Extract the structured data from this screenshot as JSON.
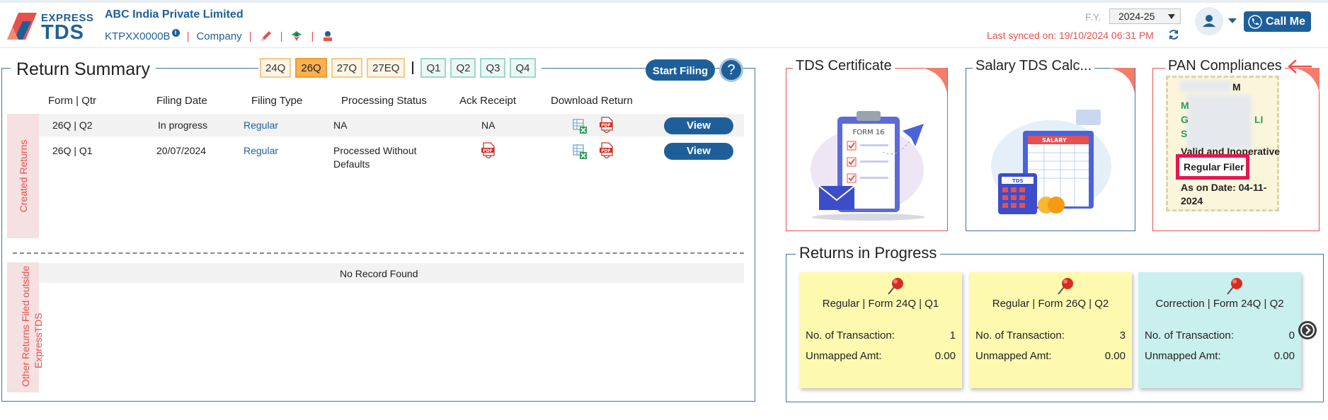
{
  "header": {
    "logo_top": "EXPRESS",
    "logo_bottom": "TDS",
    "company_name": "ABC India Private Limited",
    "tan": "KTPXX0000B",
    "tan_info_glyph": "i",
    "company_link": "Company",
    "separator": "|",
    "fy_label": "F.Y.",
    "fy_value": "2024-25",
    "last_synced": "Last synced on: 19/10/2024 06:31 PM",
    "call_me": "Call Me",
    "colors": {
      "brand": "#1f5f99",
      "accent": "#e8504f"
    }
  },
  "return_summary": {
    "title": "Return Summary",
    "form_tabs": [
      "24Q",
      "26Q",
      "27Q",
      "27EQ"
    ],
    "active_form": "26Q",
    "quarter_tabs": [
      "Q1",
      "Q2",
      "Q3",
      "Q4"
    ],
    "start_filing": "Start Filing",
    "help": "?",
    "columns": [
      "Form | Qtr",
      "Filing Date",
      "Filing Type",
      "Processing Status",
      "Ack Receipt",
      "Download Return"
    ],
    "created_label": "Created Returns",
    "rows": [
      {
        "form_qtr": "26Q | Q2",
        "filing_date": "In progress",
        "filing_type": "Regular",
        "status_line1": "NA",
        "status_line2": "",
        "ack": "NA",
        "view": "View"
      },
      {
        "form_qtr": "26Q | Q1",
        "filing_date": "20/07/2024",
        "filing_type": "Regular",
        "status_line1": "Processed Without",
        "status_line2": "Defaults",
        "ack": "",
        "view": "View"
      }
    ],
    "other_label_line1": "Other Returns Filed outside",
    "other_label_line2": "ExpressTDS",
    "no_record": "No Record Found"
  },
  "cards": {
    "tds_certificate": "TDS Certificate",
    "tds_certificate_form": "FORM 16",
    "salary_calc": "Salary TDS Calc...",
    "salary_label": "SALARY",
    "salary_tds_label": "TDS",
    "pan_compliances": "PAN Compliances",
    "pan_status": "Valid and Inoperative",
    "pan_filer": "Regular Filer",
    "pan_date_line1": "As on Date: 04-11-",
    "pan_date_line2": "2024",
    "pan_masked_1": "M",
    "pan_masked_2": "M",
    "pan_masked_3": "G",
    "pan_masked_4": "LI",
    "pan_masked_5": "S"
  },
  "returns_in_progress": {
    "title": "Returns in Progress",
    "txn_label": "No. of Transaction:",
    "amt_label": "Unmapped Amt:",
    "notes": [
      {
        "title": "Regular | Form 24Q | Q1",
        "transactions": "1",
        "unmapped": "0.00",
        "color": "yellow"
      },
      {
        "title": "Regular | Form 26Q | Q2",
        "transactions": "3",
        "unmapped": "0.00",
        "color": "yellow"
      },
      {
        "title": "Correction | Form 24Q | Q2",
        "transactions": "0",
        "unmapped": "0.00",
        "color": "cyan"
      }
    ]
  }
}
